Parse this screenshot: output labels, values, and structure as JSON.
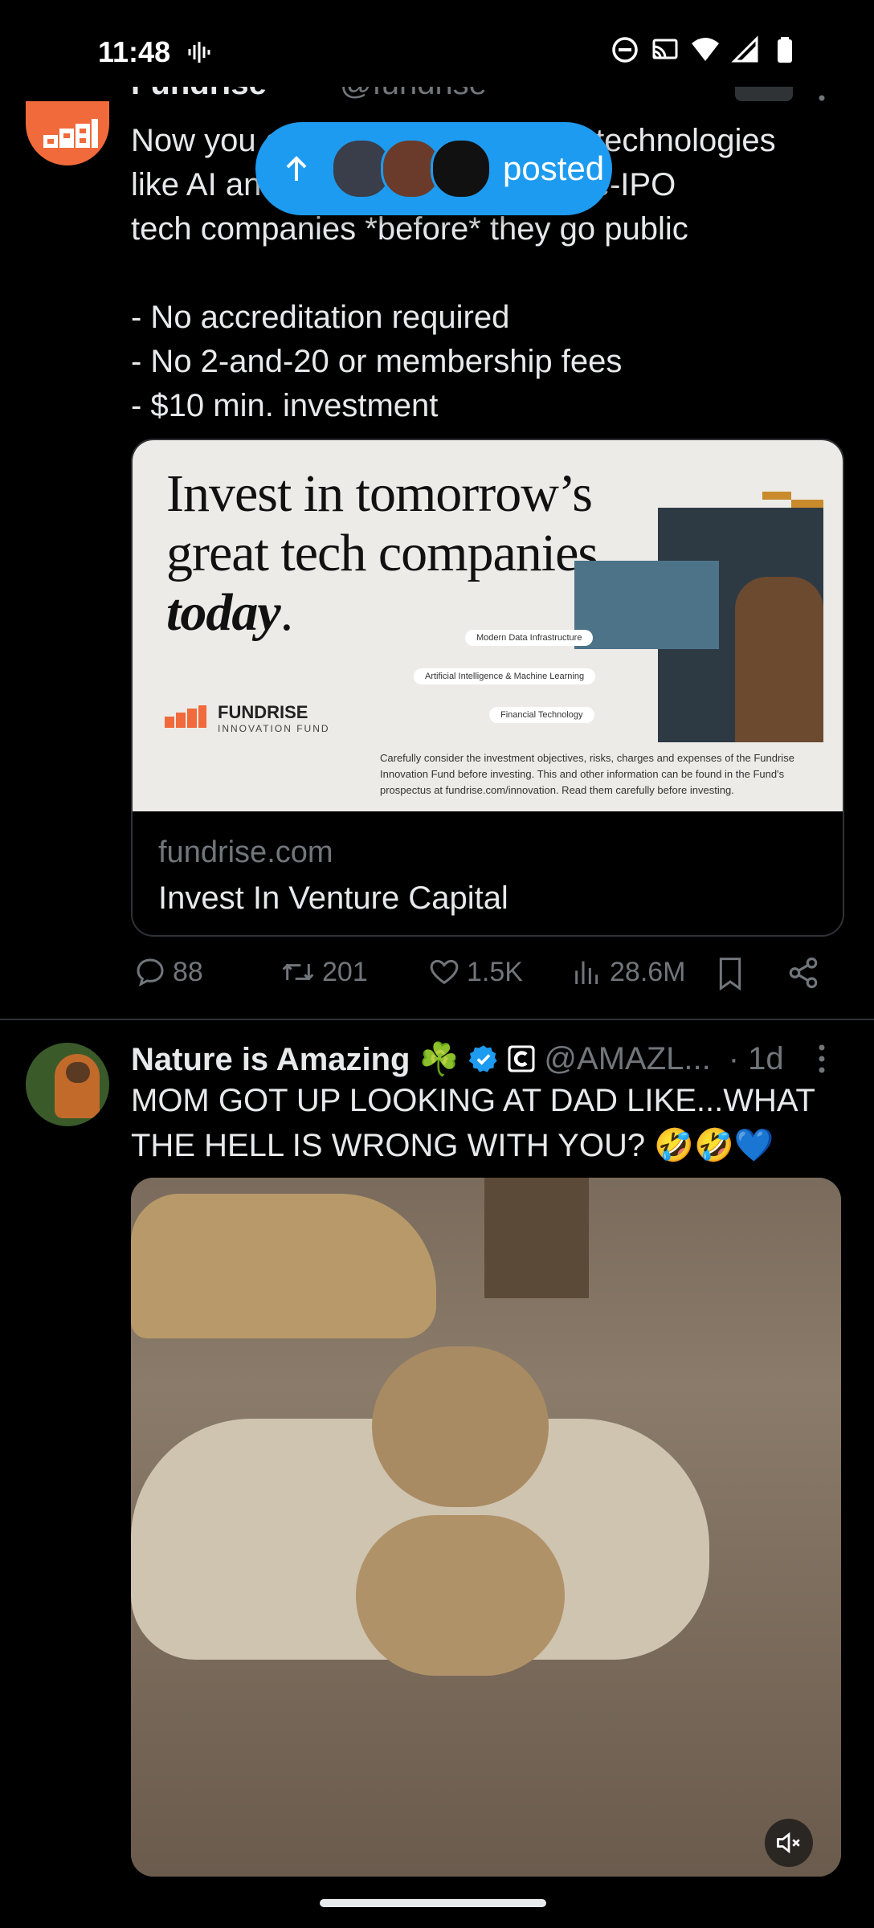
{
  "status_bar": {
    "time": "11:48"
  },
  "new_posts_pill": {
    "label": "posted"
  },
  "tweet1": {
    "lines": [
      "Now you can invest in emerging technologies",
      "like AI and fintech through top pre-IPO",
      "tech companies *before* they go public",
      "",
      "- No accreditation required",
      "- No 2-and-20 or membership fees",
      "- $10 min. investment"
    ],
    "card": {
      "headline_line1": "Invest in tomorrow’s",
      "headline_line2": "great tech companies,",
      "headline_italic": "today",
      "headline_period": ".",
      "tag1": "Modern Data Infrastructure",
      "tag2": "Artificial Intelligence & Machine Learning",
      "tag3": "Financial Technology",
      "brand": "FUNDRISE",
      "brand_sub": "INNOVATION FUND",
      "disclaimer": "Carefully consider the investment objectives, risks, charges and expenses of the Fundrise Innovation Fund before investing. This and other information can be found in the Fund's prospectus at fundrise.com/innovation. Read them carefully before investing.",
      "domain": "fundrise.com",
      "title": "Invest In Venture Capital"
    },
    "actions": {
      "replies": "88",
      "reposts": "201",
      "likes": "1.5K",
      "views": "28.6M"
    }
  },
  "tweet2": {
    "name": "Nature is Amazing ☘️",
    "handle": "@AMAZL...",
    "time": "· 1d",
    "text": "MOM GOT UP LOOKING AT DAD LIKE...WHAT THE HELL IS WRONG WITH YOU? 🤣🤣💙"
  },
  "colors": {
    "accent": "#1d9bf0",
    "brand_orange": "#f06a3c",
    "muted": "#71767b"
  }
}
